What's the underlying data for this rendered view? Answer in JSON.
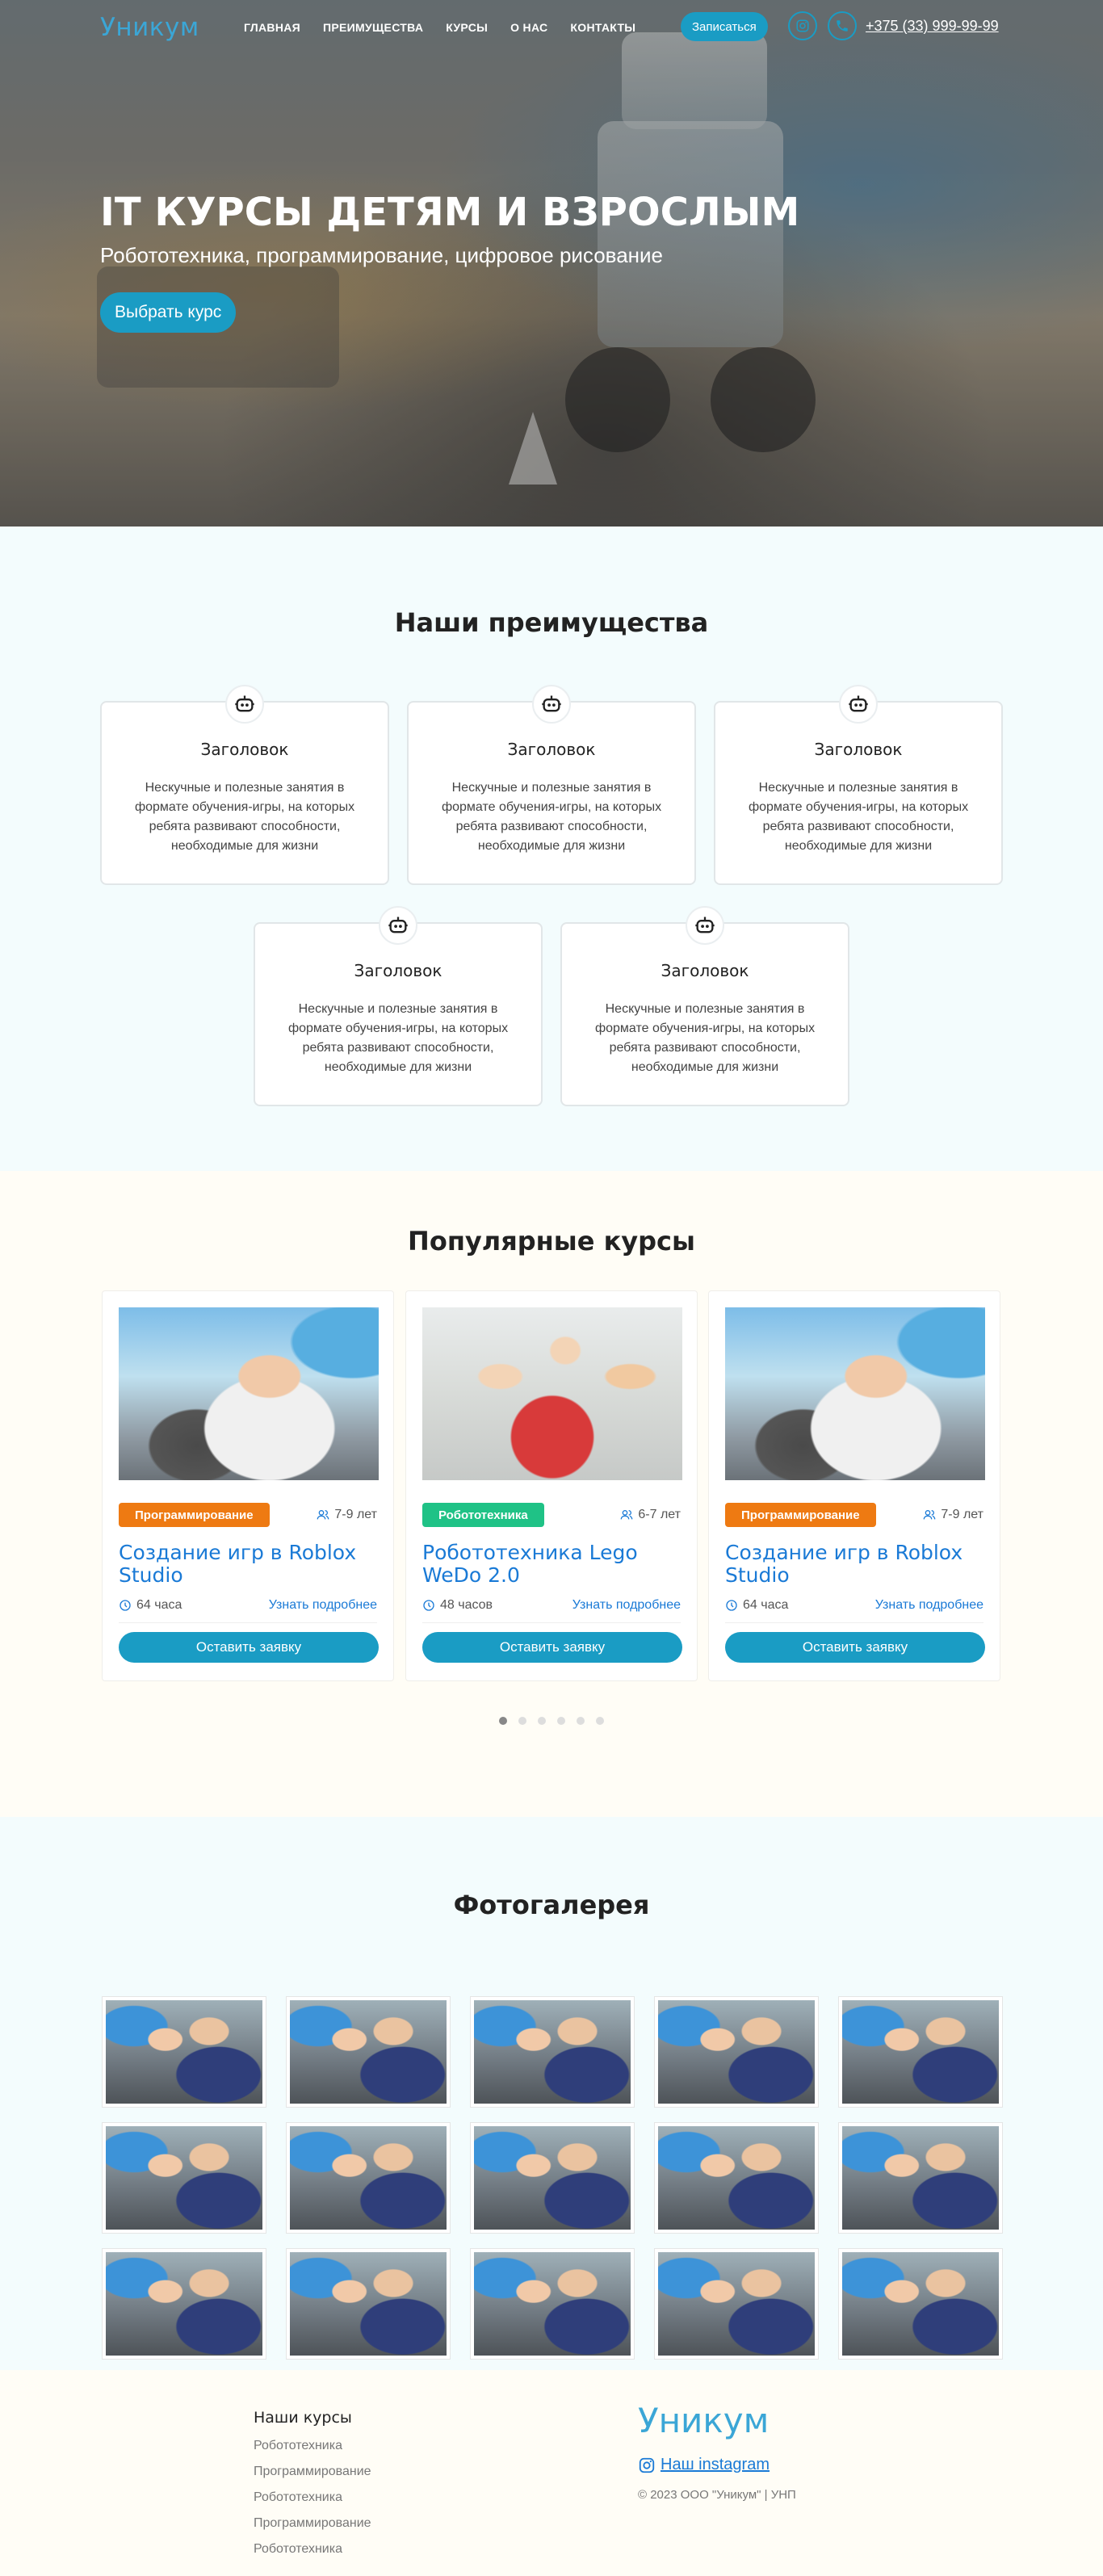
{
  "header": {
    "logo": "Уникум",
    "nav": [
      "ГЛАВНАЯ",
      "ПРЕИМУЩЕСТВА",
      "КУРСЫ",
      "О НАС",
      "КОНТАКТЫ"
    ],
    "enroll_label": "Записаться",
    "phone": "+375 (33) 999-99-99",
    "accent": "#1a9cc4"
  },
  "hero": {
    "title": "IT КУРСЫ ДЕТЯМ И ВЗРОСЛЫМ",
    "subtitle": "Робототехника, программирование, цифровое рисование",
    "button": "Выбрать курс"
  },
  "advantages": {
    "title": "Наши преимущества",
    "items": [
      {
        "icon": "robot-icon",
        "title": "Заголовок",
        "text": "Нескучные и полезные занятия в формате обучения-игры, на которых ребята развивают способности, необходимые для жизни"
      },
      {
        "icon": "robot-icon",
        "title": "Заголовок",
        "text": "Нескучные и полезные занятия в формате обучения-игры, на которых ребята развивают способности, необходимые для жизни"
      },
      {
        "icon": "robot-icon",
        "title": "Заголовок",
        "text": "Нескучные и полезные занятия в формате обучения-игры, на которых ребята развивают способности, необходимые для жизни"
      },
      {
        "icon": "robot-icon",
        "title": "Заголовок",
        "text": "Нескучные и полезные занятия в формате обучения-игры, на которых ребята развивают способности, необходимые для жизни"
      },
      {
        "icon": "robot-icon",
        "title": "Заголовок",
        "text": "Нескучные и полезные занятия в формате обучения-игры, на которых ребята развивают способности, необходимые для жизни"
      }
    ]
  },
  "courses": {
    "title": "Популярные курсы",
    "items": [
      {
        "category": "Программирование",
        "category_color": "#ee7a12",
        "age": "7-9 лет",
        "title": "Создание игр в Roblox Studio",
        "hours": "64 часа",
        "more": "Узнать подробнее",
        "apply": "Оставить заявку"
      },
      {
        "category": "Робототехника",
        "category_color": "#1fc286",
        "age": "6-7 лет",
        "title": "Робототехника Lego WeDo 2.0",
        "hours": "48 часов",
        "more": "Узнать подробнее",
        "apply": "Оставить заявку"
      },
      {
        "category": "Программирование",
        "category_color": "#ee7a12",
        "age": "7-9 лет",
        "title": "Создание игр в Roblox Studio",
        "hours": "64 часа",
        "more": "Узнать подробнее",
        "apply": "Оставить заявку"
      }
    ],
    "pages": 6,
    "active_page": 1
  },
  "gallery": {
    "title": "Фотогалерея",
    "count": 15
  },
  "footer": {
    "courses_title": "Наши курсы",
    "courses": [
      "Робототехника",
      "Программирование",
      "Робототехника",
      "Программирование",
      "Робототехника"
    ],
    "logo": "Уникум",
    "instagram": "Наш instagram",
    "copyright": "© 2023 ООО \"Уникум\" | УНП"
  }
}
